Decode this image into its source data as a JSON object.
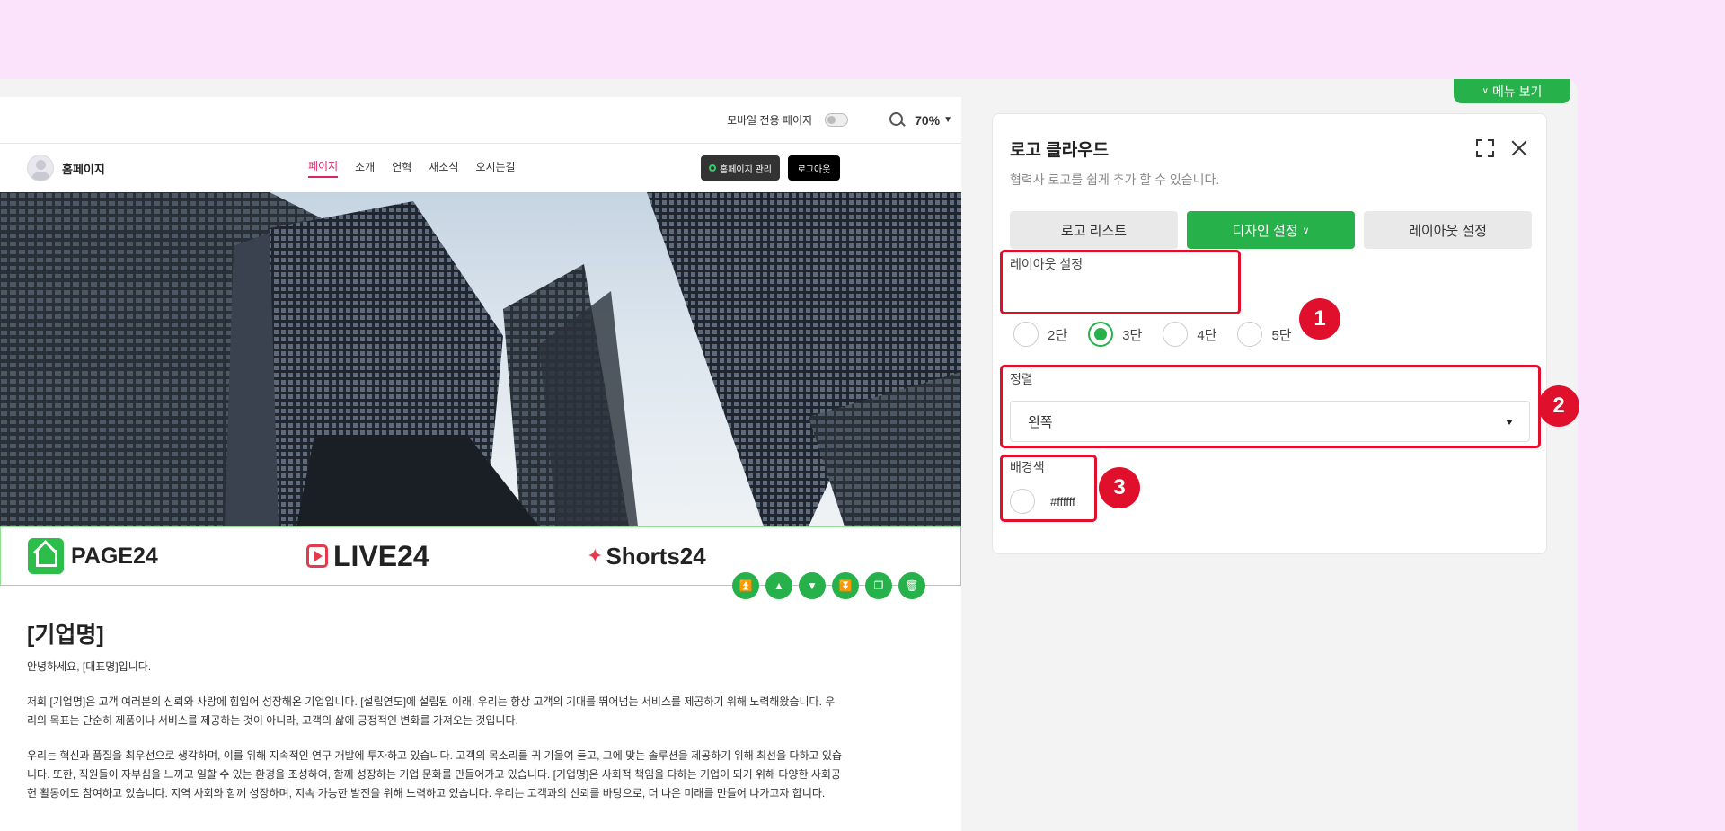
{
  "preview": {
    "mobile_label": "모바일 전용 페이지",
    "zoom": "70%",
    "site_title": "홈페이지",
    "nav": [
      {
        "label": "페이지",
        "active": true
      },
      {
        "label": "소개",
        "active": false
      },
      {
        "label": "연혁",
        "active": false
      },
      {
        "label": "새소식",
        "active": false
      },
      {
        "label": "오시는길",
        "active": false
      }
    ],
    "manage_label": "홈페이지 관리",
    "logout_label": "로그아웃",
    "logos": [
      "PAGE24",
      "LIVE24",
      "Shorts24"
    ],
    "content": {
      "heading": "[기업명]",
      "greeting": "안녕하세요, [대표명]입니다.",
      "para1": "저희 [기업명]은 고객 여러분의 신뢰와 사랑에 힘입어 성장해온 기업입니다. [설립연도]에 설립된 이래, 우리는 항상 고객의 기대를 뛰어넘는 서비스를 제공하기 위해 노력해왔습니다. 우리의 목표는 단순히 제품이나 서비스를 제공하는 것이 아니라, 고객의 삶에 긍정적인 변화를 가져오는 것입니다.",
      "para2": "우리는 혁신과 품질을 최우선으로 생각하며, 이를 위해 지속적인 연구 개발에 투자하고 있습니다. 고객의 목소리를 귀 기울여 듣고, 그에 맞는 솔루션을 제공하기 위해 최선을 다하고 있습니다. 또한, 직원들이 자부심을 느끼고 일할 수 있는 환경을 조성하여, 함께 성장하는 기업 문화를 만들어가고 있습니다. [기업명]은 사회적 책임을 다하는 기업이 되기 위해 다양한 사회공헌 활동에도 참여하고 있습니다. 지역 사회와 함께 성장하며, 지속 가능한 발전을 위해 노력하고 있습니다. 우리는 고객과의 신뢰를 바탕으로, 더 나은 미래를 만들어 나가고자 합니다."
    }
  },
  "panel": {
    "menu_view": "메뉴 보기",
    "title": "로고 클라우드",
    "desc": "협력사 로고를 쉽게 추가 할 수 있습니다.",
    "tabs": [
      {
        "label": "로고 리스트",
        "active": false
      },
      {
        "label": "디자인 설정",
        "active": true
      },
      {
        "label": "레이아웃 설정",
        "active": false
      }
    ],
    "layout": {
      "label": "레이아웃 설정",
      "options": [
        {
          "label": "2단",
          "checked": false
        },
        {
          "label": "3단",
          "checked": true
        },
        {
          "label": "4단",
          "checked": false
        },
        {
          "label": "5단",
          "checked": false
        }
      ]
    },
    "align": {
      "label": "정렬",
      "value": "왼쪽"
    },
    "bgcolor": {
      "label": "배경색",
      "value": "#ffffff"
    },
    "badges": [
      "1",
      "2",
      "3"
    ]
  },
  "colors": {
    "accent": "#26b14a",
    "highlight": "#e0102c",
    "nav_active": "#e01f6a"
  }
}
